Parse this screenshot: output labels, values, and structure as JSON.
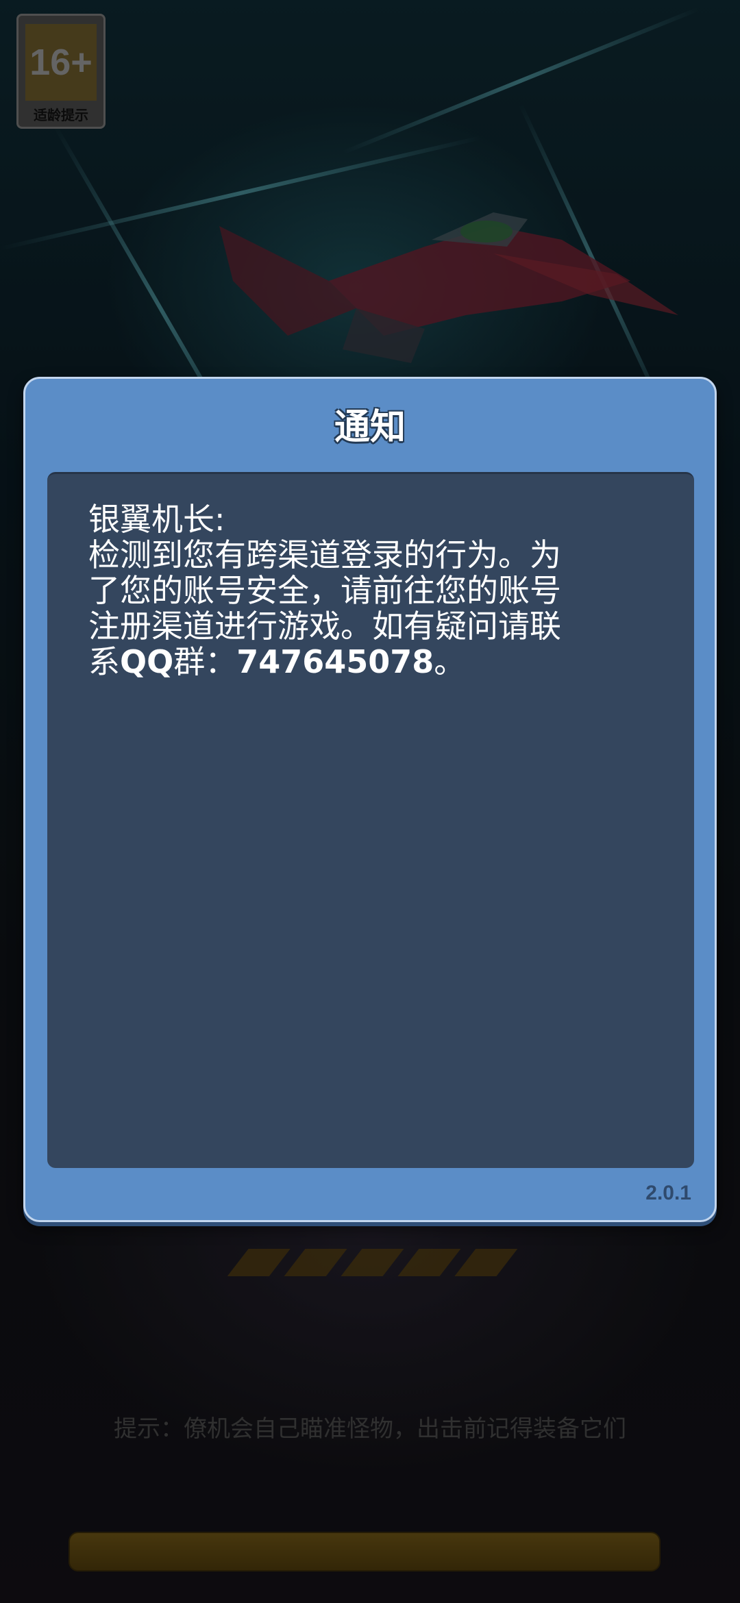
{
  "age_rating": {
    "number": "16+",
    "label": "适龄提示"
  },
  "dialog": {
    "title": "通知",
    "message_lines": [
      "银翼机长:",
      "检测到您有跨渠道登录的行为。为",
      "了您的账号安全，请前往您的账号",
      "注册渠道进行游戏。如有疑问请联"
    ],
    "last_line": {
      "prefix": "系",
      "qq_label": "QQ",
      "group": "群：",
      "number": "747645078",
      "suffix": "。"
    },
    "version": "2.0.1"
  },
  "background": {
    "tip": "提示：僚机会自己瞄准怪物，出击前记得装备它们"
  },
  "colors": {
    "dialog_frame": "#5b8dc7",
    "dialog_body": "#34465e",
    "title_text": "#ffffff",
    "loading_bar": "#6e5516"
  }
}
